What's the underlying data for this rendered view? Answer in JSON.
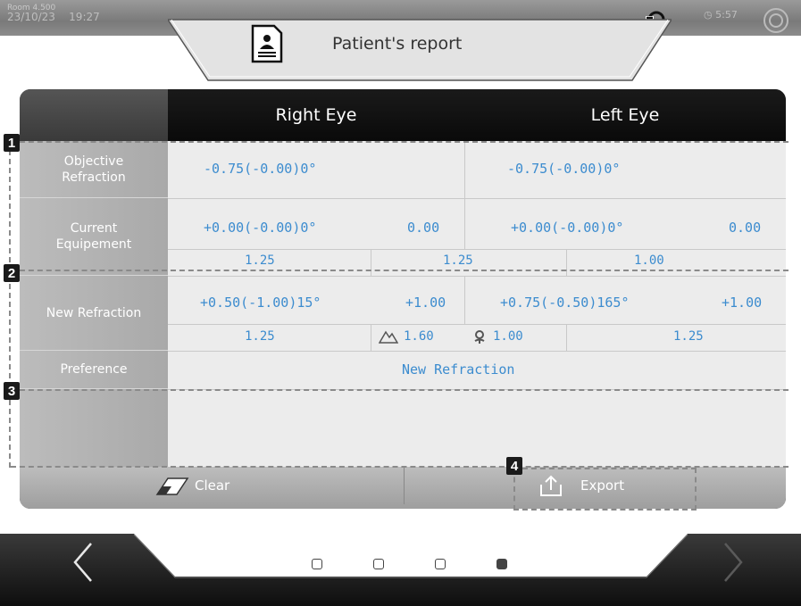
{
  "status": {
    "line1": "Room 4.500",
    "date": "23/10/23",
    "time": "19:27"
  },
  "header": {
    "title": "Patient's report",
    "timer": "5:57"
  },
  "icons": {
    "document": "document-icon",
    "connection": "connection-icon",
    "timer": "timer-icon",
    "power": "power-icon",
    "eraser": "eraser-icon",
    "export": "export-icon",
    "mountain": "mountain-icon",
    "flower": "flower-icon",
    "back": "chevron-left-icon",
    "forward": "chevron-right-icon"
  },
  "table": {
    "columns": {
      "right": "Right Eye",
      "left": "Left Eye"
    },
    "labels": {
      "objective": [
        "Objective",
        "Refraction"
      ],
      "current": [
        "Current",
        "Equipement"
      ],
      "new": "New Refraction",
      "preference": "Preference"
    },
    "objective": {
      "right": "-0.75(-0.00)0°",
      "left": "-0.75(-0.00)0°"
    },
    "current": {
      "right": "+0.00(-0.00)0°",
      "right_add": "0.00",
      "left": "+0.00(-0.00)0°",
      "left_add": "0.00",
      "va": [
        "1.25",
        "1.25",
        "1.00"
      ]
    },
    "new": {
      "right": "+0.50(-1.00)15°",
      "right_add": "+1.00",
      "left": "+0.75(-0.50)165°",
      "left_add": "+1.00",
      "va_right": "1.25",
      "va_far": "1.60",
      "va_near": "1.00",
      "va_left": "1.25"
    },
    "preference": "New Refraction"
  },
  "buttons": {
    "clear": "Clear",
    "export": "Export"
  },
  "callouts": [
    "1",
    "2",
    "3",
    "4"
  ],
  "pagination": {
    "total": 4,
    "active": 4
  },
  "colors": {
    "value": "#3c8ccf",
    "header": "#0a0a0a",
    "label_bg": "#b3b3b3"
  }
}
